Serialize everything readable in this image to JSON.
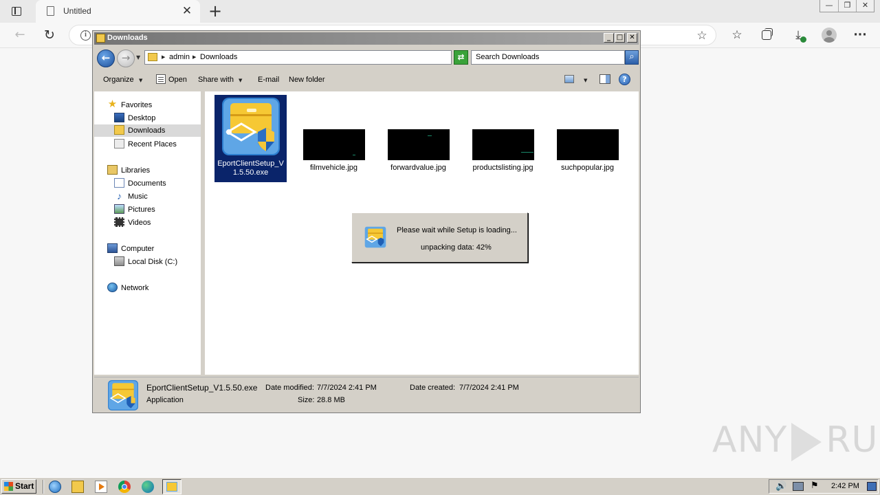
{
  "browser": {
    "tab_title": "Untitled",
    "tab_close": "✕",
    "new_tab": "+"
  },
  "window": {
    "title": "Downloads",
    "minimize": "_",
    "maximize": "□",
    "close": "✕"
  },
  "address": {
    "segments": [
      "admin",
      "Downloads"
    ],
    "search_placeholder": "Search Downloads"
  },
  "toolbar": {
    "organize": "Organize",
    "open": "Open",
    "share_with": "Share with",
    "email": "E-mail",
    "new_folder": "New folder",
    "help": "?"
  },
  "nav": {
    "favorites": "Favorites",
    "desktop": "Desktop",
    "downloads": "Downloads",
    "recent_places": "Recent Places",
    "libraries": "Libraries",
    "documents": "Documents",
    "music": "Music",
    "pictures": "Pictures",
    "videos": "Videos",
    "computer": "Computer",
    "local_disk": "Local Disk (C:)",
    "network": "Network"
  },
  "files": [
    {
      "name": "EportClientSetup_V1.5.50.exe",
      "line1": "EportClientSetup_V",
      "line2": "1.5.50.exe"
    },
    {
      "name": "filmvehicle.jpg"
    },
    {
      "name": "forwardvalue.jpg"
    },
    {
      "name": "productslisting.jpg"
    },
    {
      "name": "suchpopular.jpg"
    }
  ],
  "details": {
    "name": "EportClientSetup_V1.5.50.exe",
    "type": "Application",
    "date_modified_label": "Date modified:",
    "date_modified": "7/7/2024 2:41 PM",
    "size_label": "Size:",
    "size": "28.8 MB",
    "date_created_label": "Date created:",
    "date_created": "7/7/2024 2:41 PM"
  },
  "setup_dialog": {
    "message": "Please wait while Setup is loading...",
    "progress_text": "unpacking data: 42%",
    "progress_percent": 42
  },
  "watermark": {
    "left": "ANY",
    "right": "RUN"
  },
  "taskbar": {
    "start": "Start",
    "clock": "2:42 PM"
  },
  "icons": {
    "browser": [
      "tab-actions-icon",
      "page-icon",
      "back-arrow-icon",
      "reload-icon",
      "info-icon",
      "add-favorite-icon",
      "favorites-icon",
      "collections-icon",
      "downloads-icon",
      "profile-icon",
      "more-icon"
    ],
    "colors": {
      "selection": "#0a246a",
      "window_face": "#d4d0c8",
      "title_gradient_start": "#757575"
    }
  }
}
